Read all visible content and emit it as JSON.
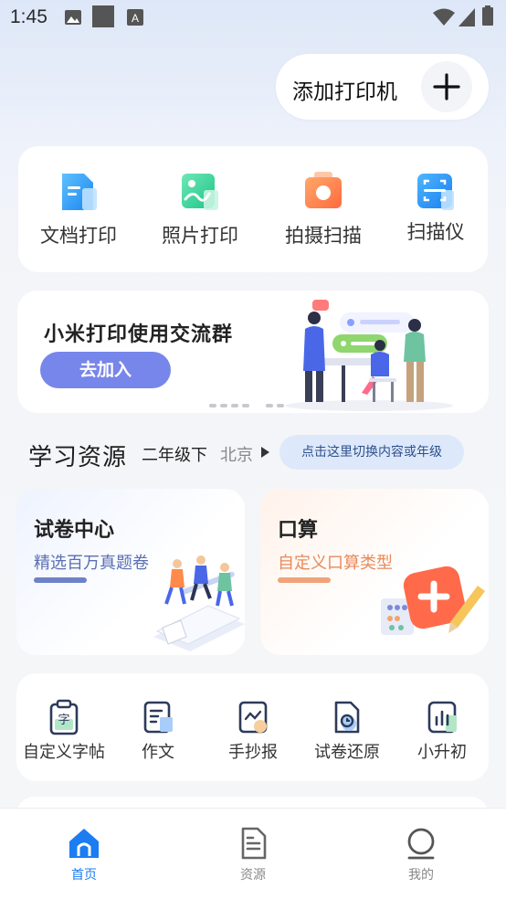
{
  "status_bar": {
    "time": "1:45"
  },
  "header": {
    "add_printer_label": "添加打印机"
  },
  "tools": [
    {
      "label": "文档打印",
      "icon": "document-print-icon"
    },
    {
      "label": "照片打印",
      "icon": "photo-print-icon"
    },
    {
      "label": "拍摄扫描",
      "icon": "camera-scan-icon"
    },
    {
      "label": "扫描仪",
      "icon": "scanner-icon"
    }
  ],
  "banner": {
    "title": "小米打印使用交流群",
    "button": "去加入"
  },
  "study": {
    "title": "学习资源",
    "grade": "二年级下",
    "city": "北京",
    "switch_hint": "点击这里切换内容或年级"
  },
  "resources": [
    {
      "title": "试卷中心",
      "subtitle": "精选百万真题卷",
      "accent": "#5a6fb3"
    },
    {
      "title": "口算",
      "subtitle": "自定义口算类型",
      "accent": "#e88a5a"
    }
  ],
  "quick_tools": [
    {
      "label": "自定义字帖",
      "icon": "copybook-icon"
    },
    {
      "label": "作文",
      "icon": "essay-icon"
    },
    {
      "label": "手抄报",
      "icon": "handwritten-newspaper-icon"
    },
    {
      "label": "试卷还原",
      "icon": "paper-restore-icon"
    },
    {
      "label": "小升初",
      "icon": "chart-icon"
    }
  ],
  "tabbar": [
    {
      "label": "首页",
      "active": true
    },
    {
      "label": "资源",
      "active": false
    },
    {
      "label": "我的",
      "active": false
    }
  ],
  "colors": {
    "primary": "#1c7cf2",
    "banner_button": "#7786ea",
    "inactive_tab": "#888888"
  }
}
